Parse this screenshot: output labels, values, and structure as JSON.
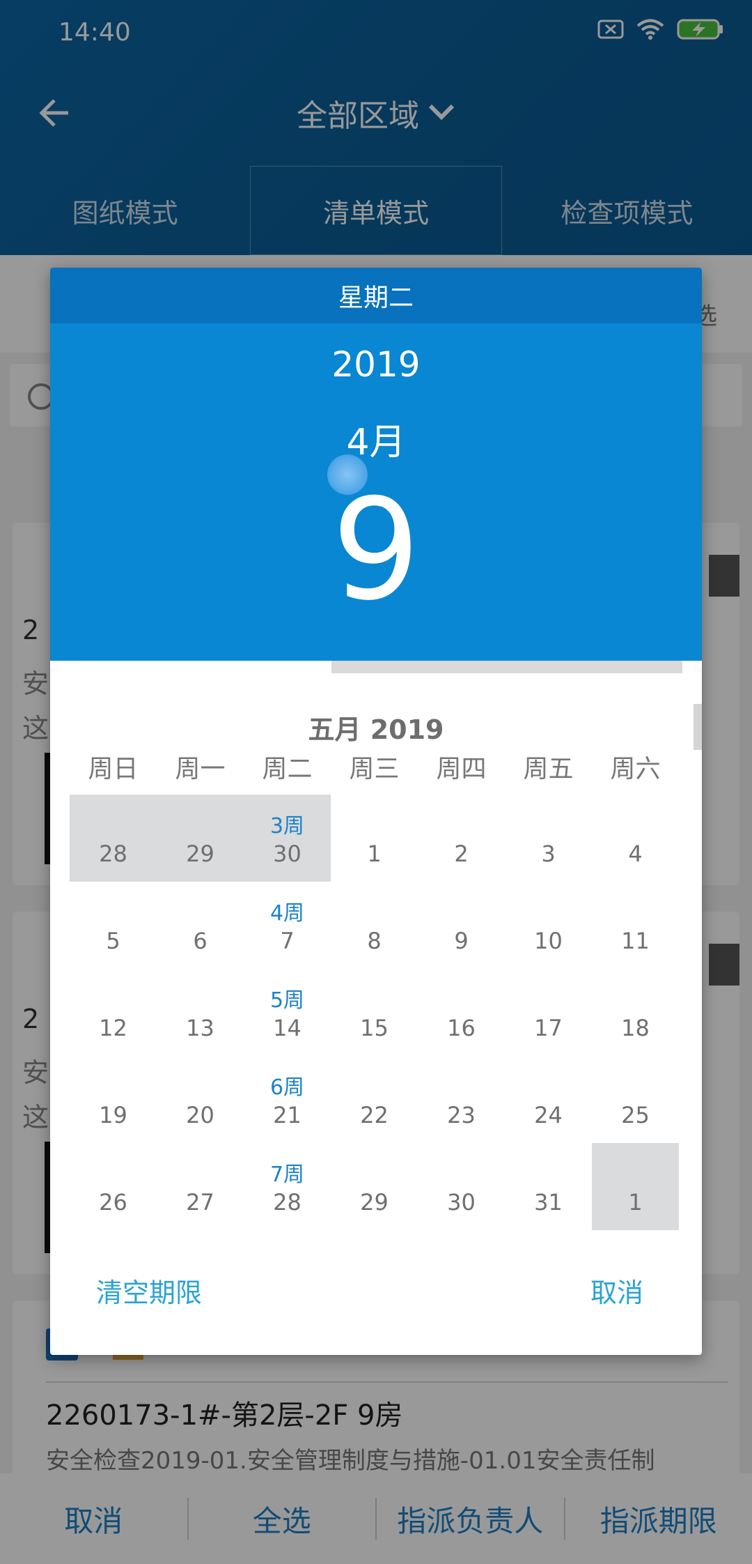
{
  "status_bar": {
    "time": "14:40",
    "icons": [
      "sim-off-icon",
      "wifi-icon",
      "battery-charging-icon"
    ]
  },
  "header": {
    "title": "全部区域",
    "tabs": [
      "图纸模式",
      "清单模式",
      "检查项模式"
    ],
    "active_tab": 1
  },
  "background": {
    "filter_tail": "选",
    "cards": [
      {
        "title_fragment": "2",
        "line1": "安",
        "line2": "这"
      },
      {
        "title_fragment": "2",
        "line1": "安",
        "line2": "这"
      },
      {
        "title": "2260173-1#-第2层-2F 9房",
        "desc": "安全检查2019-01.安全管理制度与措施-01.01安全责任制"
      }
    ]
  },
  "bottom_bar": {
    "buttons": [
      "取消",
      "全选",
      "指派负责人",
      "指派期限"
    ]
  },
  "date_picker": {
    "weekday": "星期二",
    "year": "2019",
    "month": "4月",
    "day": "9",
    "calendar_title": "五月 2019",
    "dow": [
      "周日",
      "周一",
      "周二",
      "周三",
      "周四",
      "周五",
      "周六"
    ],
    "weeks": [
      {
        "week": "3周",
        "days": [
          "28",
          "29",
          "30",
          "1",
          "2",
          "3",
          "4"
        ]
      },
      {
        "week": "4周",
        "days": [
          "5",
          "6",
          "7",
          "8",
          "9",
          "10",
          "11"
        ]
      },
      {
        "week": "5周",
        "days": [
          "12",
          "13",
          "14",
          "15",
          "16",
          "17",
          "18"
        ]
      },
      {
        "week": "6周",
        "days": [
          "19",
          "20",
          "21",
          "22",
          "23",
          "24",
          "25"
        ]
      },
      {
        "week": "7周",
        "days": [
          "26",
          "27",
          "28",
          "29",
          "30",
          "31",
          "1"
        ]
      }
    ],
    "clear_label": "清空期限",
    "cancel_label": "取消",
    "colors": {
      "weekday_bar": "#0872be",
      "header": "#0987d2",
      "week_label": "#1d83c8",
      "action": "#2aa3d3",
      "out_of_month": "#dadbdd"
    }
  }
}
